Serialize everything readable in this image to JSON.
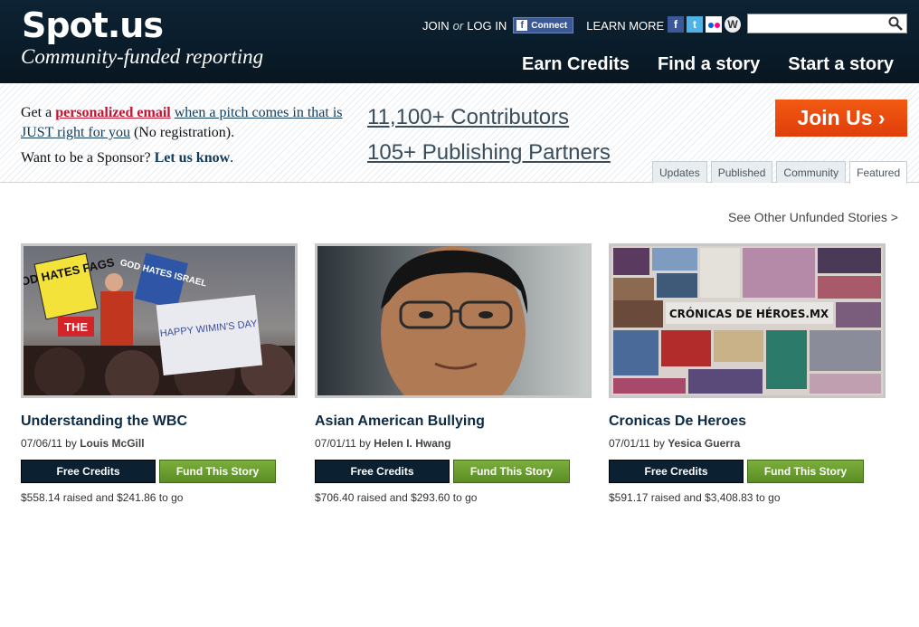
{
  "header": {
    "logo": "Spot.us",
    "tagline": "Community-funded reporting",
    "join": "JOIN",
    "or": "or",
    "login": "LOG IN",
    "fb_connect": "Connect",
    "learn_more": "LEARN MORE",
    "search_placeholder": "",
    "nav": [
      "Earn Credits",
      "Find a story",
      "Start a story"
    ],
    "social_icons": [
      "facebook-icon",
      "twitter-icon",
      "flickr-icon",
      "wordpress-icon"
    ]
  },
  "promo": {
    "get_a": "Get a",
    "personalized_email": "personalized email",
    "when_pitch": "when a pitch comes in that is JUST right for you",
    "no_registration": "(No registration).",
    "sponsor_q": "Want to be a Sponsor?",
    "let_us_know": "Let us know",
    "period": "."
  },
  "stats": {
    "contributors": "11,100+ Contributors",
    "partners": "105+ Publishing Partners"
  },
  "join_button": "Join Us ›",
  "tabs": [
    "Updates",
    "Published",
    "Community",
    "Featured"
  ],
  "other_link": "See Other Unfunded Stories >",
  "stories": [
    {
      "title": "Understanding the WBC",
      "date": "07/06/11",
      "by": "by",
      "author": "Louis McGill",
      "credits_label": "Free Credits",
      "fund_label": "Fund This Story",
      "raised": "$558.14 raised and $241.86 to go",
      "image_signs": [
        "GOD HATES FAGS",
        "GOD HATES ISRAEL",
        "THE",
        "HAPPY WIMIN'S DAY"
      ]
    },
    {
      "title": "Asian American Bullying",
      "date": "07/01/11",
      "by": "by",
      "author": "Helen I. Hwang",
      "credits_label": "Free Credits",
      "fund_label": "Fund This Story",
      "raised": "$706.40 raised and $293.60 to go"
    },
    {
      "title": "Cronicas De Heroes",
      "date": "07/01/11",
      "by": "by",
      "author": "Yesica Guerra",
      "credits_label": "Free Credits",
      "fund_label": "Fund This Story",
      "raised": "$591.17 raised and $3,408.83 to go",
      "image_text": "CRÓNICAS DE HÉROES.MX"
    }
  ],
  "colors": {
    "header_bg": "#0a1c2a",
    "join_orange": "#e8480e",
    "fund_green": "#6a9e30",
    "credits_navy": "#0b2031",
    "promo_red": "#c4122f"
  }
}
